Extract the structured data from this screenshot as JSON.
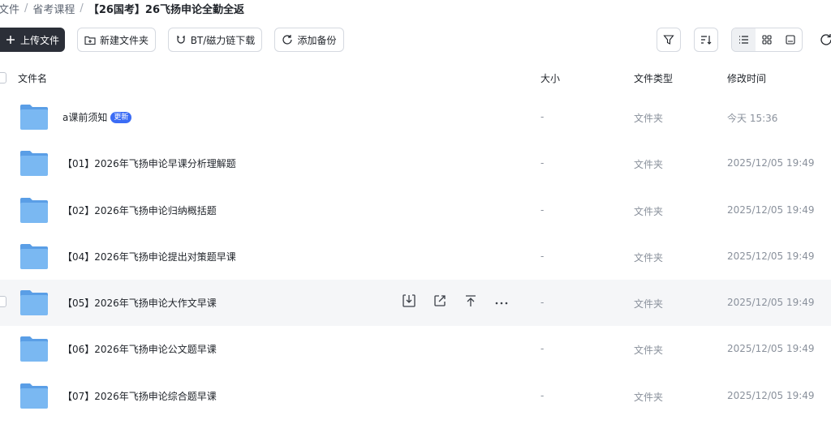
{
  "breadcrumb": {
    "items": [
      "文件",
      "省考课程"
    ],
    "separator": "/",
    "current": "【26国考】26飞扬申论全勤全返"
  },
  "toolbar": {
    "upload_label": "上传文件",
    "new_folder_label": "新建文件夹",
    "bt_label": "BT/磁力链下载",
    "backup_label": "添加备份"
  },
  "table": {
    "headers": {
      "name": "文件名",
      "size": "大小",
      "type": "文件类型",
      "mtime": "修改时间"
    },
    "rows": [
      {
        "name": "a课前须知",
        "badge": "更新",
        "size": "-",
        "type": "文件夹",
        "mtime": "今天 15:36"
      },
      {
        "name": "【01】2026年飞扬申论早课分析理解题",
        "badge": "",
        "size": "-",
        "type": "文件夹",
        "mtime": "2025/12/05 19:49"
      },
      {
        "name": "【02】2026年飞扬申论归纳概括题",
        "badge": "",
        "size": "-",
        "type": "文件夹",
        "mtime": "2025/12/05 19:49"
      },
      {
        "name": "【04】2026年飞扬申论提出对策题早课",
        "badge": "",
        "size": "-",
        "type": "文件夹",
        "mtime": "2025/12/05 19:49"
      },
      {
        "name": "【05】2026年飞扬申论大作文早课",
        "badge": "",
        "size": "-",
        "type": "文件夹",
        "mtime": "2025/12/05 19:49"
      },
      {
        "name": "【06】2026年飞扬申论公文题早课",
        "badge": "",
        "size": "-",
        "type": "文件夹",
        "mtime": "2025/12/05 19:49"
      },
      {
        "name": "【07】2026年飞扬申论综合题早课",
        "badge": "",
        "size": "-",
        "type": "文件夹",
        "mtime": "2025/12/05 19:49"
      }
    ]
  },
  "colors": {
    "primary_button": "#2b2f38",
    "badge": "#3b6cf5",
    "folder": "#6eaef0",
    "hover_row": "#f5f6f8"
  },
  "icons": {
    "upload": "plus-icon",
    "new_folder": "folder-plus-icon",
    "bt": "magnet-icon",
    "backup": "refresh-icon",
    "filter": "filter-icon",
    "sort": "sort-icon",
    "list_view": "list-icon",
    "grid_view": "grid-icon",
    "large_view": "image-icon",
    "refresh": "refresh-icon",
    "row_download": "download-icon",
    "row_share": "share-icon",
    "row_top": "pin-top-icon",
    "row_more": "more-icon"
  }
}
